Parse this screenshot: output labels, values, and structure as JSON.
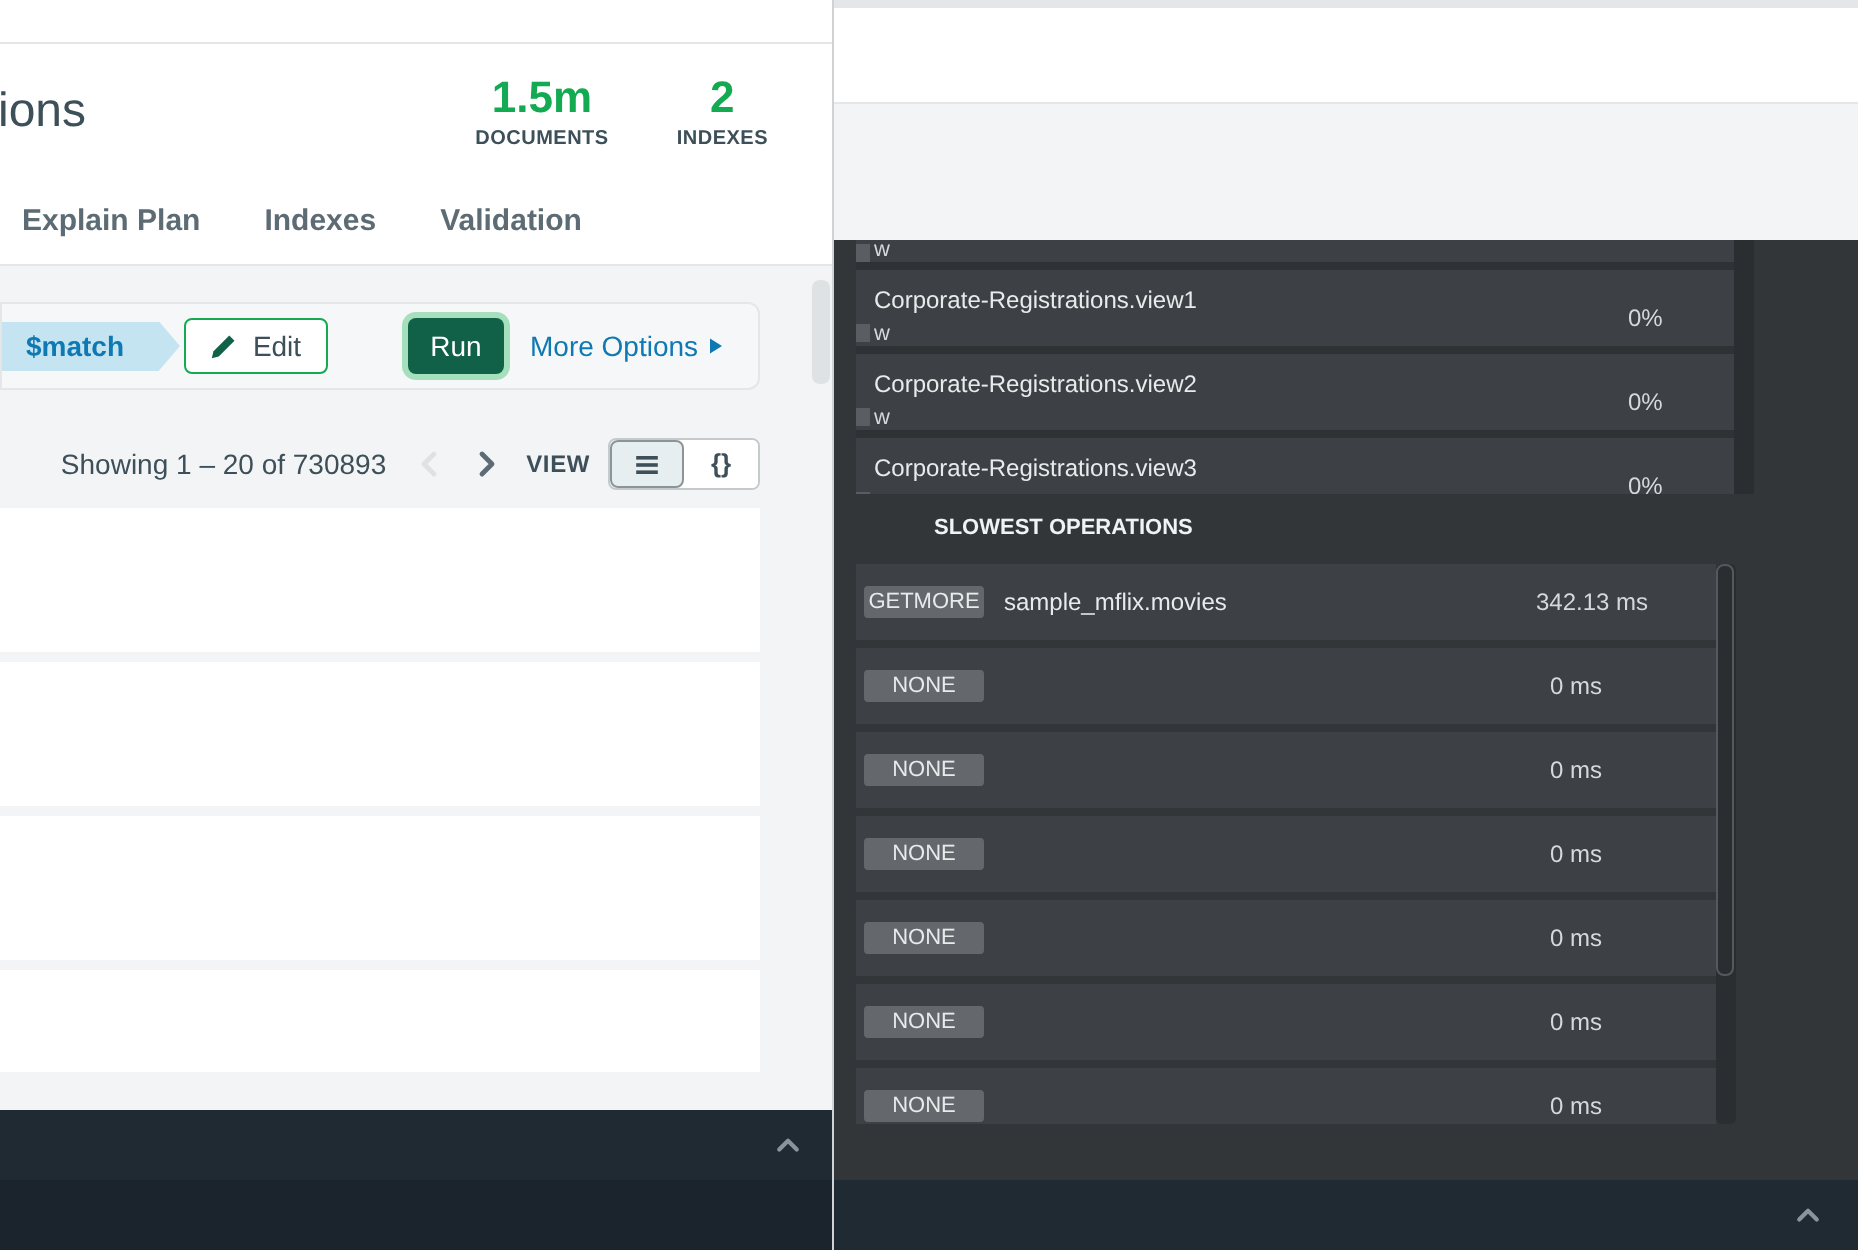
{
  "collection_window": {
    "title": "ions",
    "stats": [
      {
        "value": "1.5m",
        "label": "DOCUMENTS"
      },
      {
        "value": "2",
        "label": "INDEXES"
      }
    ],
    "tabs": [
      {
        "label": "Explain Plan",
        "selected": false
      },
      {
        "label": "Indexes",
        "selected": false
      },
      {
        "label": "Validation",
        "selected": false
      }
    ],
    "pipeline": {
      "stage": "$match",
      "edit_button": "Edit",
      "run_button": "Run",
      "more_options": "More Options"
    },
    "pagination": {
      "text": "Showing 1 – 20 of 730893",
      "prev_disabled": true,
      "view_label": "VIEW",
      "views": [
        {
          "kind": "list",
          "selected": true
        },
        {
          "kind": "json",
          "label": "{}",
          "selected": false
        }
      ]
    },
    "documents": [
      {
        "kind": "card"
      },
      {
        "kind": "card"
      },
      {
        "kind": "card"
      },
      {
        "kind": "card"
      }
    ]
  },
  "performance": {
    "collections": [
      {
        "tail": "w"
      },
      {
        "name": "Corporate-Registrations.view1",
        "usage": "0%",
        "tail": "w"
      },
      {
        "name": "Corporate-Registrations.view2",
        "usage": "0%",
        "tail": "w"
      },
      {
        "name": "Corporate-Registrations.view3",
        "usage": "0%"
      }
    ],
    "slowest_title": "SLOWEST OPERATIONS",
    "operations": [
      {
        "op": "GETMORE",
        "namespace": "sample_mflix.movies",
        "duration": "342.13 ms"
      },
      {
        "op": "NONE",
        "duration": "0 ms"
      },
      {
        "op": "NONE",
        "duration": "0 ms"
      },
      {
        "op": "NONE",
        "duration": "0 ms"
      },
      {
        "op": "NONE",
        "duration": "0 ms"
      },
      {
        "op": "NONE",
        "duration": "0 ms"
      },
      {
        "op": "NONE",
        "duration": "0 ms"
      }
    ]
  }
}
